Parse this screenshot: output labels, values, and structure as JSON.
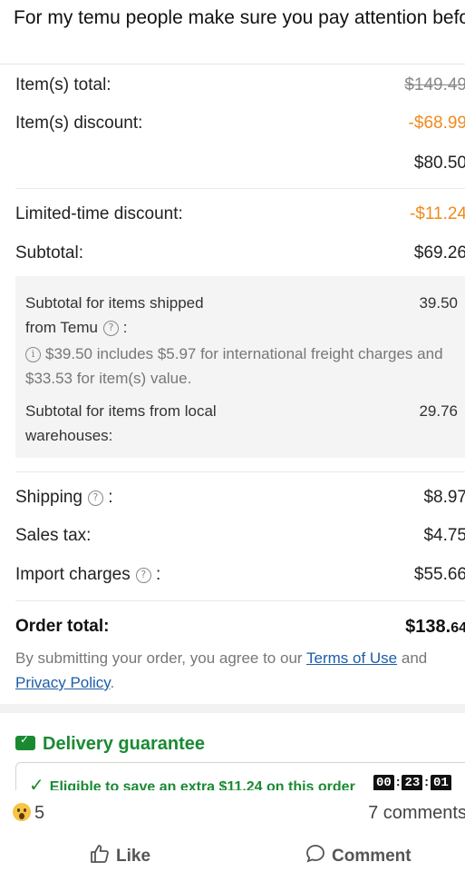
{
  "caption": "For my temu people make sure you pay attention before you check out, luckily I caught it",
  "summary": {
    "items_total": {
      "label": "Item(s) total:",
      "value": "$149.49"
    },
    "items_discount": {
      "label": "Item(s) discount:",
      "value": "-$68.99"
    },
    "after_discount": {
      "value": "$80.50"
    },
    "limited_discount": {
      "label": "Limited-time discount:",
      "value": "-$11.24"
    },
    "subtotal": {
      "label": "Subtotal:",
      "value": "$69.26"
    }
  },
  "breakdown": {
    "temu_label_line1": "Subtotal for items shipped",
    "temu_label_line2": "from Temu",
    "temu_colon": ":",
    "temu_value": "39.50",
    "note": "$39.50 includes $5.97 for international freight charges and $33.53 for item(s) value.",
    "local_label_line1": "Subtotal for items from local",
    "local_label_line2": "warehouses:",
    "local_value": "29.76"
  },
  "charges": {
    "shipping": {
      "label": "Shipping",
      "value": "$8.97"
    },
    "sales_tax": {
      "label": "Sales tax:",
      "value": "$4.75"
    },
    "import": {
      "label": "Import charges",
      "value": "$55.66"
    },
    "colon": ":"
  },
  "order_total": {
    "label": "Order total:",
    "value_main": "$138.",
    "value_cents": "64"
  },
  "terms": {
    "prefix": "By submitting your order, you agree to our",
    "terms_link": "Terms of Use",
    "and": "and",
    "privacy_link": "Privacy Policy",
    "suffix": "."
  },
  "delivery": {
    "title": "Delivery guarantee",
    "eligible": "Eligible to save an extra $11.24 on this order",
    "timer": [
      "00",
      "23",
      "01"
    ]
  },
  "footer": {
    "reaction_count": "5",
    "comments": "7 comments",
    "like": "Like",
    "comment": "Comment"
  },
  "icons": {
    "help": "question-circle-icon",
    "info": "info-circle-icon",
    "truck": "delivery-truck-icon",
    "check": "check-icon",
    "wow": "wow-reaction-icon",
    "like": "thumbs-up-icon",
    "comment": "comment-bubble-icon"
  },
  "colors": {
    "discount": "#f18a1c",
    "guarantee_green": "#1a8a32",
    "link_blue": "#1b5ea8"
  }
}
